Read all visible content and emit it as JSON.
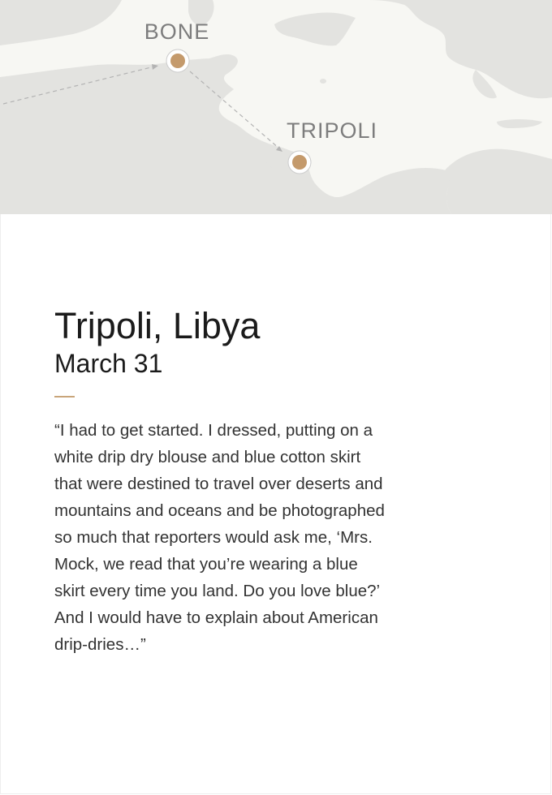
{
  "map": {
    "colors": {
      "sea": "#f7f7f3",
      "land": "#e3e3e0",
      "marker": "#c49a6c",
      "route": "#b3b3b3",
      "label": "#7d7d7d"
    },
    "cities": [
      {
        "name": "BONE",
        "icon": "location-marker-icon"
      },
      {
        "name": "TRIPOLI",
        "icon": "location-marker-icon"
      }
    ]
  },
  "entry": {
    "title": "Tripoli, Libya",
    "date": "March 31",
    "accent_color": "#c9a57a",
    "quote": "“I had to get started.  I dressed, putting on a white drip dry blouse and blue cotton skirt that were destined to travel over deserts and mountains and oceans and be photographed so much that reporters would ask me, ‘Mrs. Mock, we read that you’re wearing a blue skirt every time you land.  Do you love blue?’  And I would have to explain about American drip-dries…”"
  }
}
